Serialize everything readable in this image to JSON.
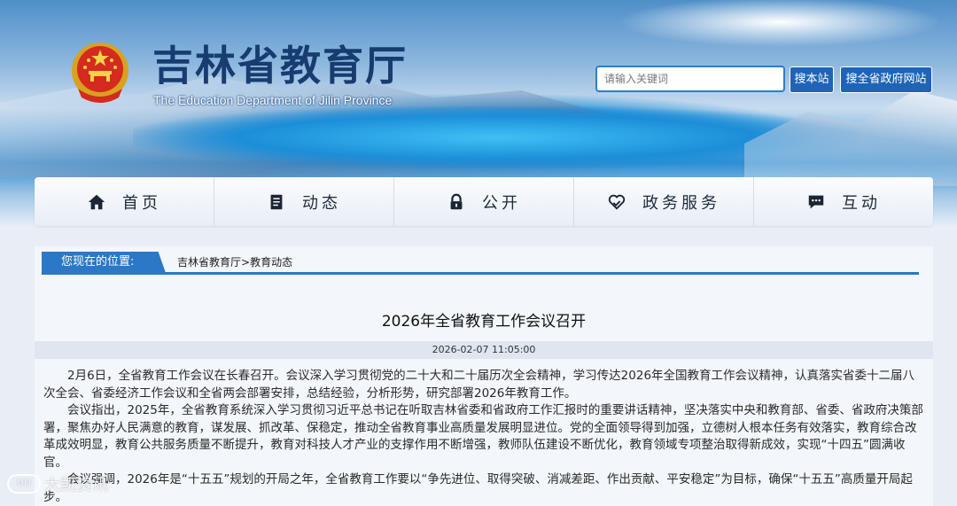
{
  "header": {
    "title": "吉林省教育厅",
    "subtitle": "The Education Department of Jilin Province",
    "search_placeholder": "请输入关键词",
    "search_site_label": "搜本站",
    "search_gov_label": "搜全省政府网站"
  },
  "nav": {
    "items": [
      {
        "label": "首页",
        "icon": "home-icon"
      },
      {
        "label": "动态",
        "icon": "document-icon"
      },
      {
        "label": "公开",
        "icon": "lock-icon"
      },
      {
        "label": "政务服务",
        "icon": "heart-hand-icon"
      },
      {
        "label": "互动",
        "icon": "chat-icon"
      }
    ]
  },
  "breadcrumb": {
    "label": "您现在的位置:",
    "crumb_home": "吉林省教育厅",
    "separator": ">",
    "crumb_current": "教育动态"
  },
  "article": {
    "title": "2026年全省教育工作会议召开",
    "date": "2026-02-07 11:05:00",
    "paragraphs": [
      "2月6日，全省教育工作会议在长春召开。会议深入学习贯彻党的二十大和二十届历次全会精神，学习传达2026年全国教育工作会议精神，认真落实省委十二届八次全会、省委经济工作会议和全省两会部署安排，总结经验，分析形势，研究部署2026年教育工作。",
      "会议指出，2025年，全省教育系统深入学习贯彻习近平总书记在听取吉林省委和省政府工作汇报时的重要讲话精神，坚决落实中央和教育部、省委、省政府决策部署，聚焦办好人民满意的教育，谋发展、抓改革、保稳定，推动全省教育事业高质量发展明显进位。党的全面领导得到加强，立德树人根本任务有效落实，教育综合改革成效明显，教育公共服务质量不断提升，教育对科技人才产业的支撑作用不断增强，教师队伍建设不断优化，教育领域专项整治取得新成效，实现“十四五”圆满收官。",
      "会议强调，2026年是“十五五”规划的开局之年，全省教育工作要以“争先进位、取得突破、消减差距、作出贡献、平安稳定”为目标，确保“十五五”高质量开局起步。"
    ]
  },
  "watermark": {
    "text": "大凯资讯"
  },
  "colors": {
    "brand_blue": "#2a78c6",
    "title_blue": "#173c6f",
    "button_blue": "#1f64b5"
  }
}
